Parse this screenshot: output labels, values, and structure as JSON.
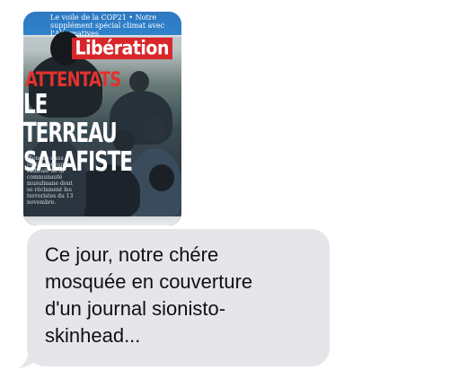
{
  "conversation": {
    "image_message": {
      "photo": {
        "masthead_teaser": "Le voile de la COP21 • Notre supplément spécial climat avec l'Alternatives",
        "logo": "Libération",
        "headline_kicker": "ATTENTATS",
        "headline_lines": [
          "LE TERREAU",
          "SALAFISTE"
        ],
        "deck": "Plongée dans cette mouvance radicale de la communauté musulmane dont se réclament les terroristes du 13 novembre."
      }
    },
    "text_message": {
      "text": "Ce jour, notre chére\nmosquée en couverture\nd'un journal sionisto-\nskinhead..."
    },
    "colors": {
      "received_bubble": "#e5e5ea",
      "message_text": "#111111",
      "logo_red": "#d8262a",
      "headline_red": "#e3322e"
    }
  }
}
